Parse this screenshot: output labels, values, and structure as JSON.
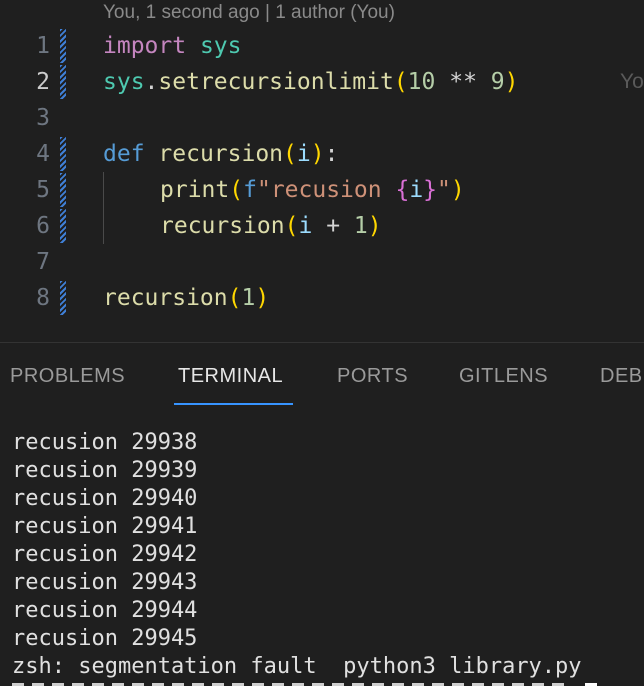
{
  "editor": {
    "blame_header": "You, 1 second ago | 1 author (You)",
    "inline_blame": "Yo",
    "current_line": 2,
    "lines": [
      {
        "num": "1"
      },
      {
        "num": "2"
      },
      {
        "num": "3"
      },
      {
        "num": "4"
      },
      {
        "num": "5"
      },
      {
        "num": "6"
      },
      {
        "num": "7"
      },
      {
        "num": "8"
      }
    ],
    "tokens": {
      "l1_kw": "import",
      "l1_mod": "sys",
      "l2_mod": "sys",
      "l2_dot": ".",
      "l2_fn": "setrecursionlimit",
      "l2_open": "(",
      "l2_num1": "10",
      "l2_op": "**",
      "l2_num2": "9",
      "l2_close": ")",
      "l4_kw": "def",
      "l4_fn": "recursion",
      "l4_open": "(",
      "l4_param": "i",
      "l4_close": ")",
      "l4_colon": ":",
      "l5_fn": "print",
      "l5_open": "(",
      "l5_fprefix": "f",
      "l5_str1": "\"recusion ",
      "l5_brace_open": "{",
      "l5_var": "i",
      "l5_brace_close": "}",
      "l5_str2": "\"",
      "l5_close": ")",
      "l6_fn": "recursion",
      "l6_open": "(",
      "l6_param": "i",
      "l6_op": "+",
      "l6_num": "1",
      "l6_close": ")",
      "l8_fn": "recursion",
      "l8_open": "(",
      "l8_num": "1",
      "l8_close": ")"
    }
  },
  "panel": {
    "tabs": [
      {
        "label": "PROBLEMS"
      },
      {
        "label": "TERMINAL"
      },
      {
        "label": "PORTS"
      },
      {
        "label": "GITLENS"
      },
      {
        "label": "DEB"
      }
    ],
    "active_tab": "TERMINAL"
  },
  "terminal": {
    "lines": [
      "recusion 29938",
      "recusion 29939",
      "recusion 29940",
      "recusion 29941",
      "recusion 29942",
      "recusion 29943",
      "recusion 29944",
      "recusion 29945",
      "zsh: segmentation fault  python3 library.py"
    ]
  },
  "colors": {
    "background": "#1f1f1f",
    "accent": "#3794ff",
    "git_modified": "#3f7fd6"
  }
}
